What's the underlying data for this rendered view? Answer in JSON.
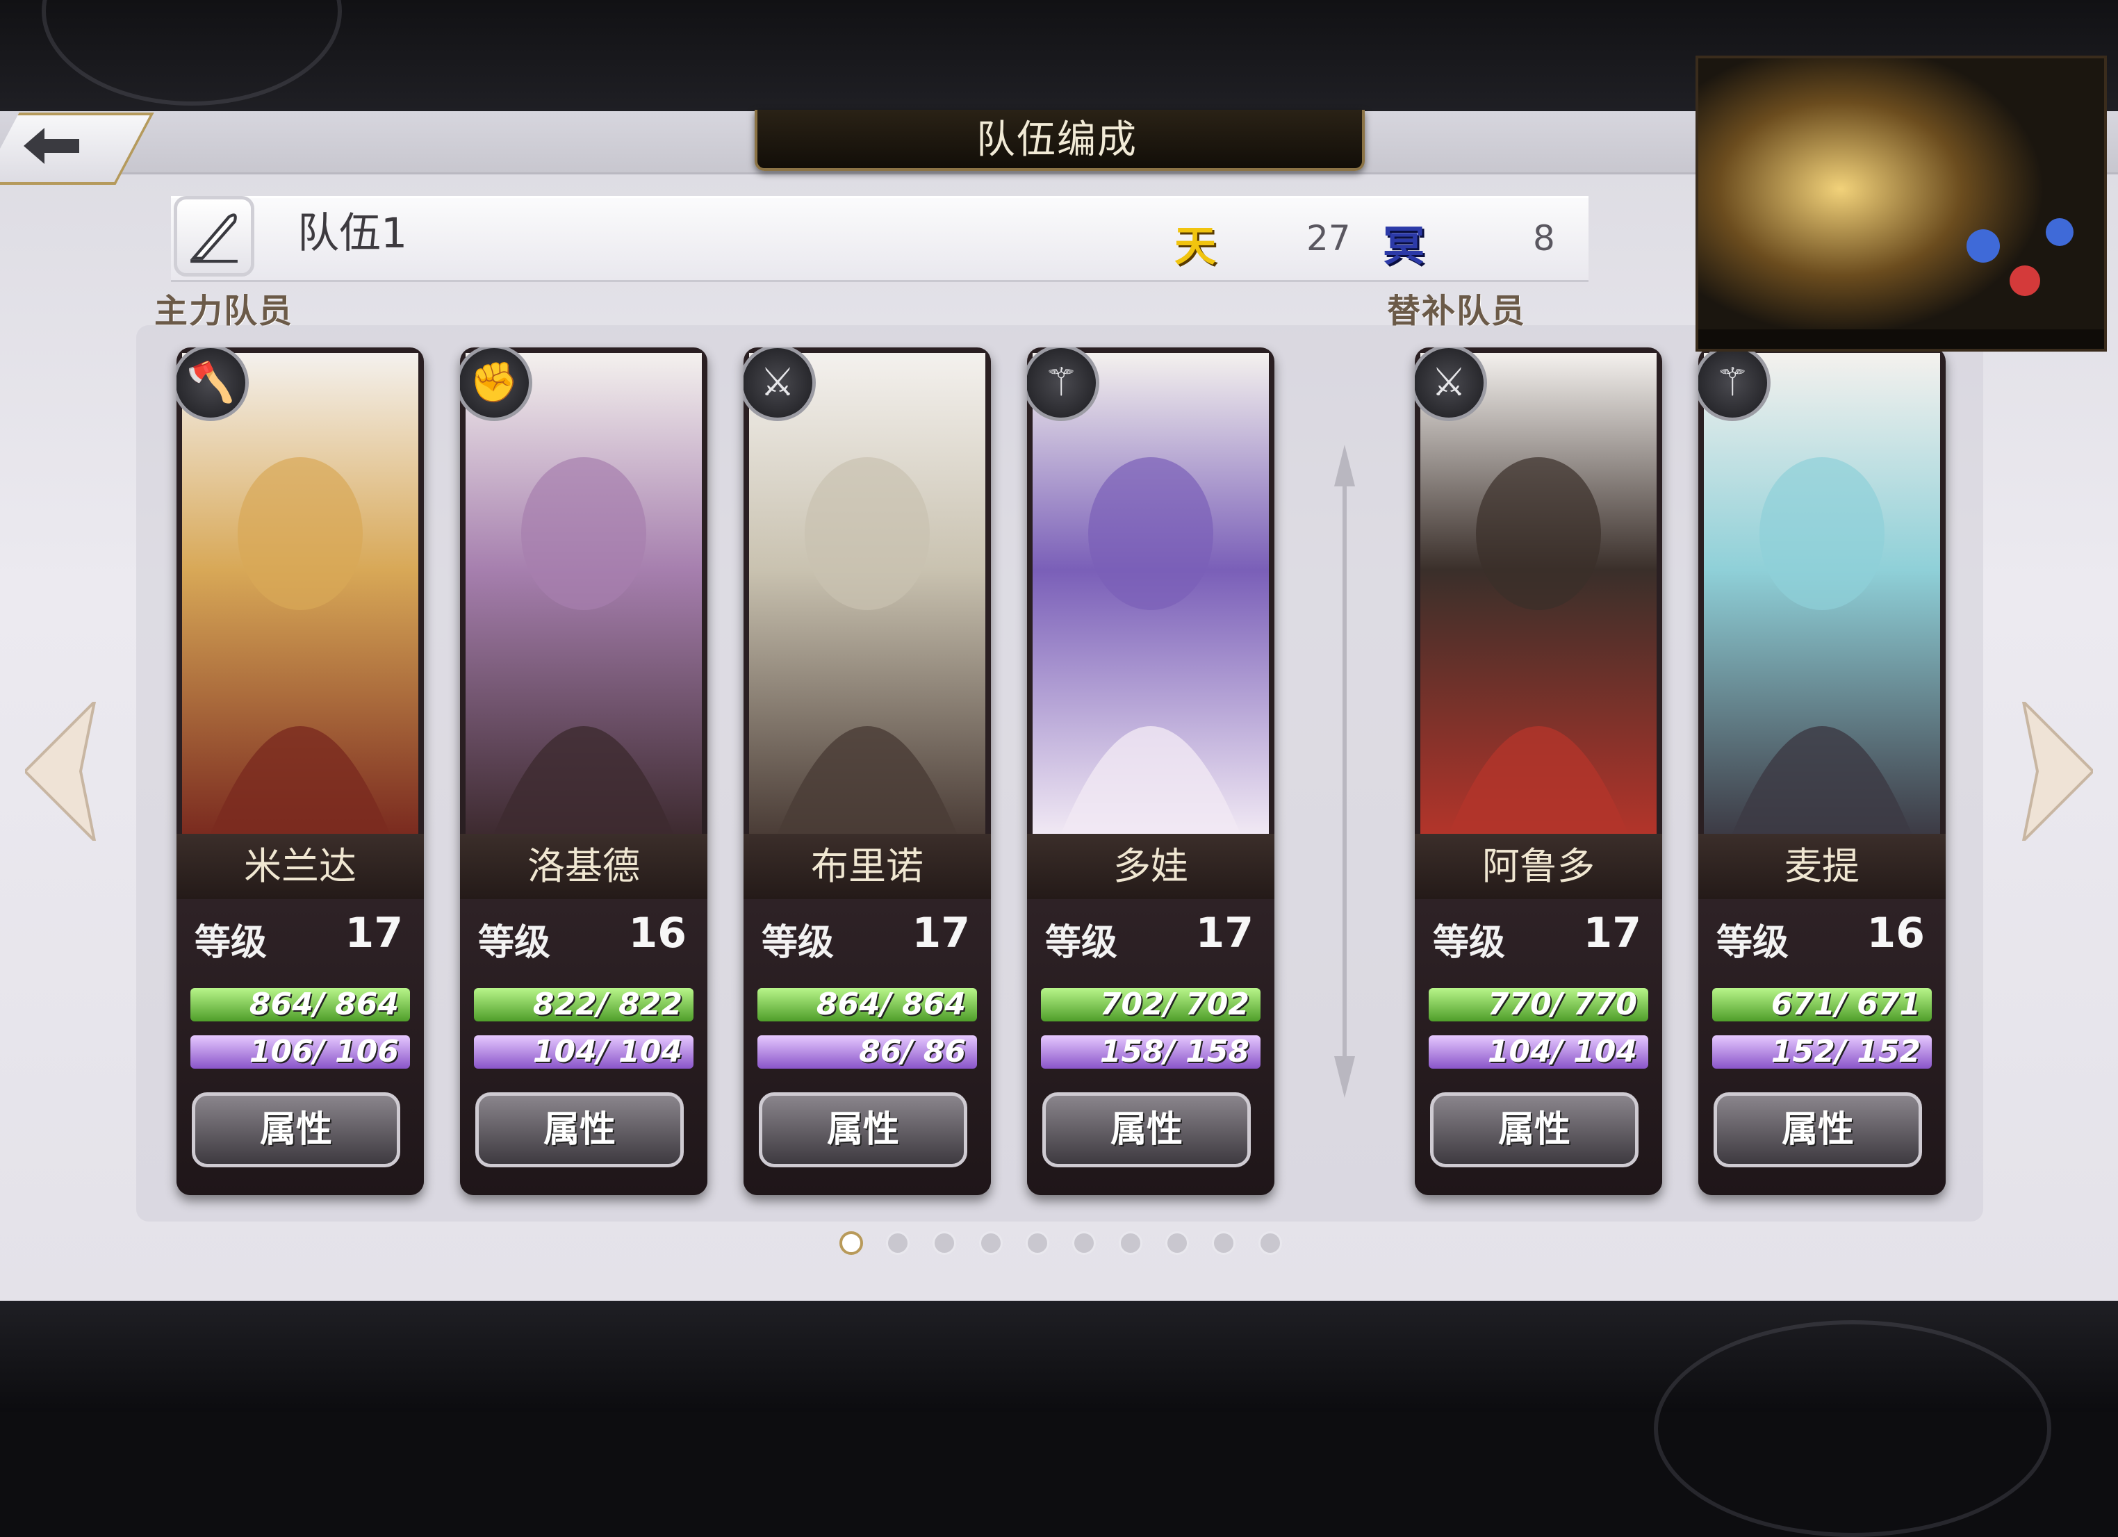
{
  "header": {
    "title": "队伍编成"
  },
  "team": {
    "name": "队伍1",
    "ten_label": "天",
    "ten_count": "27",
    "ming_label": "冥",
    "ming_count": "8"
  },
  "sections": {
    "main": "主力队员",
    "sub": "替补队员"
  },
  "members": [
    {
      "name": "米兰达",
      "level_label": "等级",
      "level": "17",
      "hp": "864/ 864",
      "hp_frac": 1.0,
      "mp": "106/ 106",
      "mp_frac": 1.0,
      "button": "属性",
      "role_icon": "axe-icon"
    },
    {
      "name": "洛基德",
      "level_label": "等级",
      "level": "16",
      "hp": "822/ 822",
      "hp_frac": 1.0,
      "mp": "104/ 104",
      "mp_frac": 1.0,
      "button": "属性",
      "role_icon": "fist-icon"
    },
    {
      "name": "布里诺",
      "level_label": "等级",
      "level": "17",
      "hp": "864/ 864",
      "hp_frac": 1.0,
      "mp": "86/ 86",
      "mp_frac": 1.0,
      "button": "属性",
      "role_icon": "sword-icon"
    },
    {
      "name": "多娃",
      "level_label": "等级",
      "level": "17",
      "hp": "702/ 702",
      "hp_frac": 1.0,
      "mp": "158/ 158",
      "mp_frac": 1.0,
      "button": "属性",
      "role_icon": "staff-icon"
    },
    {
      "name": "阿鲁多",
      "level_label": "等级",
      "level": "17",
      "hp": "770/ 770",
      "hp_frac": 1.0,
      "mp": "104/ 104",
      "mp_frac": 1.0,
      "button": "属性",
      "role_icon": "sword-icon"
    },
    {
      "name": "麦提",
      "level_label": "等级",
      "level": "16",
      "hp": "671/ 671",
      "hp_frac": 1.0,
      "mp": "152/ 152",
      "mp_frac": 1.0,
      "button": "属性",
      "role_icon": "staff-icon"
    }
  ],
  "pagination": {
    "pages": 10,
    "current": 1
  },
  "colors": {
    "accent_gold": "#b89a5a",
    "hp_green": "#4f9e2a",
    "mp_purple": "#8a55c9",
    "ten_yellow": "#f1c40f",
    "ming_blue": "#2c3aa8"
  }
}
